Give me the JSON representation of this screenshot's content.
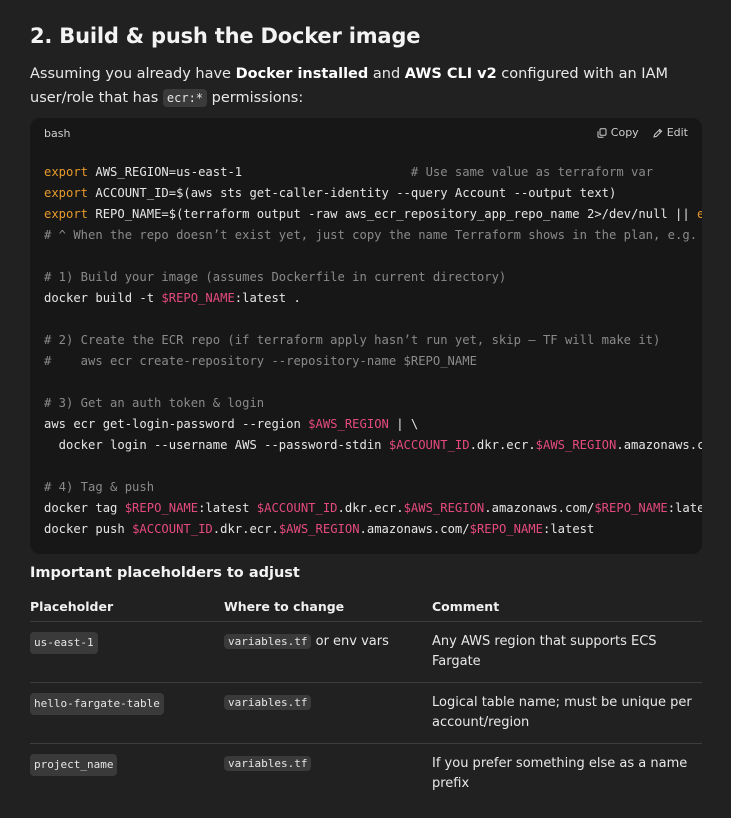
{
  "section": {
    "heading": "2. Build & push the Docker image",
    "intro": {
      "t1": "Assuming you already have ",
      "b1": "Docker installed",
      "t2": " and ",
      "b2": "AWS CLI v2",
      "t3": " configured with an IAM user/role that has ",
      "code": "ecr:*",
      "t4": " permissions:"
    }
  },
  "code_block": {
    "language": "bash",
    "copy_label": "Copy",
    "edit_label": "Edit",
    "lines": [
      [
        {
          "k": "kw",
          "t": "export"
        },
        {
          "k": "p",
          "t": " AWS_REGION=us-east-1                       "
        },
        {
          "k": "cm",
          "t": "# Use same value as terraform var"
        }
      ],
      [
        {
          "k": "kw",
          "t": "export"
        },
        {
          "k": "p",
          "t": " ACCOUNT_ID=$(aws sts get-caller-identity --query Account --output text)"
        }
      ],
      [
        {
          "k": "kw",
          "t": "export"
        },
        {
          "k": "p",
          "t": " REPO_NAME=$(terraform output -raw aws_ecr_repository_app_repo_name 2>/dev/null || "
        },
        {
          "k": "kw",
          "t": "e"
        }
      ],
      [
        {
          "k": "cm",
          "t": "# ^ When the repo doesn’t exist yet, just copy the name Terraform shows in the plan, e.g."
        }
      ],
      [],
      [
        {
          "k": "cm",
          "t": "# 1) Build your image (assumes Dockerfile in current directory)"
        }
      ],
      [
        {
          "k": "p",
          "t": "docker build -t "
        },
        {
          "k": "var",
          "t": "$REPO_NAME"
        },
        {
          "k": "p",
          "t": ":latest ."
        }
      ],
      [],
      [
        {
          "k": "cm",
          "t": "# 2) Create the ECR repo (if terraform apply hasn’t run yet, skip – TF will make it)"
        }
      ],
      [
        {
          "k": "cm",
          "t": "#    aws ecr create-repository --repository-name $REPO_NAME"
        }
      ],
      [],
      [
        {
          "k": "cm",
          "t": "# 3) Get an auth token & login"
        }
      ],
      [
        {
          "k": "p",
          "t": "aws ecr get-login-password --region "
        },
        {
          "k": "var",
          "t": "$AWS_REGION"
        },
        {
          "k": "p",
          "t": " | \\"
        }
      ],
      [
        {
          "k": "p",
          "t": "  docker login --username AWS --password-stdin "
        },
        {
          "k": "var",
          "t": "$ACCOUNT_ID"
        },
        {
          "k": "p",
          "t": ".dkr.ecr."
        },
        {
          "k": "var",
          "t": "$AWS_REGION"
        },
        {
          "k": "p",
          "t": ".amazonaws.c"
        }
      ],
      [],
      [
        {
          "k": "cm",
          "t": "# 4) Tag & push"
        }
      ],
      [
        {
          "k": "p",
          "t": "docker tag "
        },
        {
          "k": "var",
          "t": "$REPO_NAME"
        },
        {
          "k": "p",
          "t": ":latest "
        },
        {
          "k": "var",
          "t": "$ACCOUNT_ID"
        },
        {
          "k": "p",
          "t": ".dkr.ecr."
        },
        {
          "k": "var",
          "t": "$AWS_REGION"
        },
        {
          "k": "p",
          "t": ".amazonaws.com/"
        },
        {
          "k": "var",
          "t": "$REPO_NAME"
        },
        {
          "k": "p",
          "t": ":late"
        }
      ],
      [
        {
          "k": "p",
          "t": "docker push "
        },
        {
          "k": "var",
          "t": "$ACCOUNT_ID"
        },
        {
          "k": "p",
          "t": ".dkr.ecr."
        },
        {
          "k": "var",
          "t": "$AWS_REGION"
        },
        {
          "k": "p",
          "t": ".amazonaws.com/"
        },
        {
          "k": "var",
          "t": "$REPO_NAME"
        },
        {
          "k": "p",
          "t": ":latest"
        }
      ]
    ]
  },
  "placeholders": {
    "heading": "Important placeholders to adjust",
    "columns": [
      "Placeholder",
      "Where to change",
      "Comment"
    ],
    "rows": [
      {
        "placeholder": "us-east-1",
        "where_code": "variables.tf",
        "where_text": " or env vars",
        "comment": "Any AWS region that supports ECS Fargate"
      },
      {
        "placeholder": "hello-fargate-table",
        "where_code": "variables.tf",
        "where_text": "",
        "comment": "Logical table name; must be unique per account/region"
      },
      {
        "placeholder": "project_name",
        "where_code": "variables.tf",
        "where_text": "",
        "comment": "If you prefer something else as a name prefix"
      }
    ]
  },
  "icons": {
    "copy": "copy-icon",
    "edit": "pencil-icon"
  },
  "colors": {
    "background": "#212121",
    "code_background": "#171717",
    "keyword": "#e79a2b",
    "variable": "#e44a7d",
    "comment": "#8a8a8a"
  }
}
